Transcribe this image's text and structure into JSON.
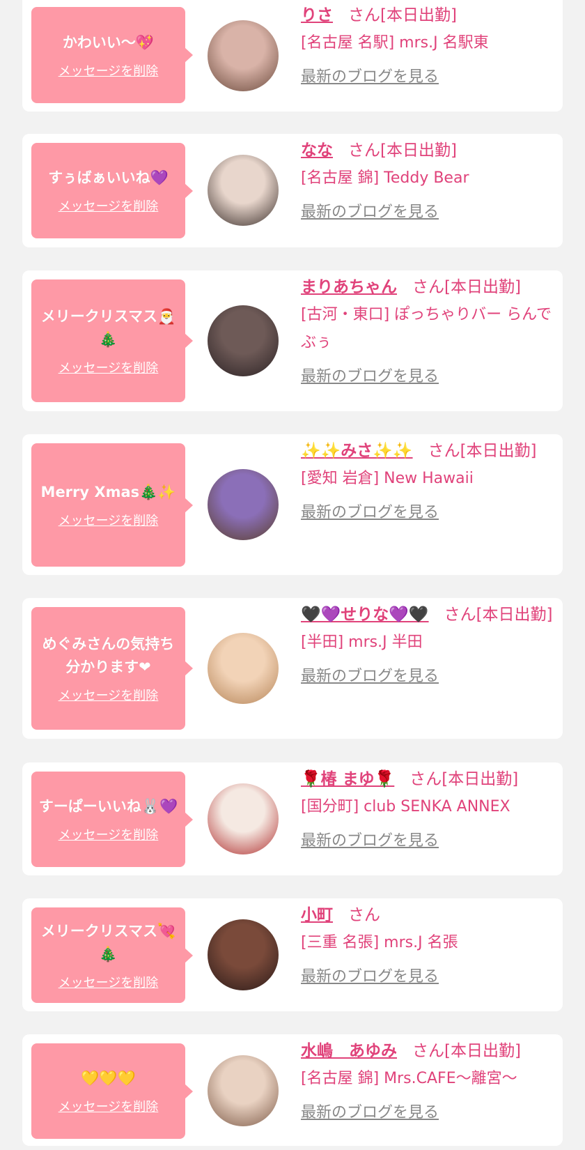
{
  "items": [
    {
      "message": "かわいい〜💖",
      "delete_label": "メッセージを削除",
      "name": "りさ",
      "suffix": "さん[本日出勤]",
      "shop": "[名古屋 名駅] mrs.J 名駅東",
      "blog_label": "最新のブログを見る"
    },
    {
      "message": "すぅばぁいいね💜",
      "delete_label": "メッセージを削除",
      "name": "なな",
      "suffix": "さん[本日出勤]",
      "shop": "[名古屋 錦] Teddy Bear",
      "blog_label": "最新のブログを見る"
    },
    {
      "message": "メリークリスマス🎅🎄",
      "delete_label": "メッセージを削除",
      "name": "まりあちゃん",
      "suffix": "さん[本日出勤]",
      "shop": "[古河・東口] ぽっちゃりバー らんでぶぅ",
      "blog_label": "最新のブログを見る"
    },
    {
      "message": "Merry Xmas🎄✨",
      "delete_label": "メッセージを削除",
      "name": "✨✨みさ✨✨",
      "suffix": "さん[本日出勤]",
      "shop": "[愛知 岩倉] New Hawaii",
      "blog_label": "最新のブログを見る"
    },
    {
      "message": "めぐみさんの気持ち分かります❤",
      "delete_label": "メッセージを削除",
      "name": "🖤💜せりな💜🖤",
      "suffix": "さん[本日出勤]",
      "shop": "[半田] mrs.J 半田",
      "blog_label": "最新のブログを見る"
    },
    {
      "message": "すーぱーいいね🐰💜",
      "delete_label": "メッセージを削除",
      "name": "🌹椿 まゆ🌹",
      "suffix": "さん[本日出勤]",
      "shop": "[国分町] club SENKA ANNEX",
      "blog_label": "最新のブログを見る"
    },
    {
      "message": "メリークリスマス💘🎄",
      "delete_label": "メッセージを削除",
      "name": "小町",
      "suffix": "さん",
      "shop": "[三重 名張] mrs.J 名張",
      "blog_label": "最新のブログを見る"
    },
    {
      "message": "💛💛💛",
      "delete_label": "メッセージを削除",
      "name": "水嶋　あゆみ",
      "suffix": "さん[本日出勤]",
      "shop": "[名古屋 錦] Mrs.CAFE～離宮～",
      "blog_label": "最新のブログを見る"
    }
  ],
  "colors": {
    "accent": "#e0427a",
    "bubble": "#fe99a6",
    "link_gray": "#888888"
  },
  "avatar_colors": [
    [
      "#d9b3a8",
      "#6b4a3c"
    ],
    [
      "#e8d6cc",
      "#3a2e2a"
    ],
    [
      "#6e5a57",
      "#2b2224"
    ],
    [
      "#8b6fb8",
      "#5a3f2b"
    ],
    [
      "#f2d3b7",
      "#b58457"
    ],
    [
      "#f5e9e2",
      "#b03030"
    ],
    [
      "#7a4a3a",
      "#2a1a18"
    ],
    [
      "#e9d2c2",
      "#7e5b48"
    ]
  ]
}
